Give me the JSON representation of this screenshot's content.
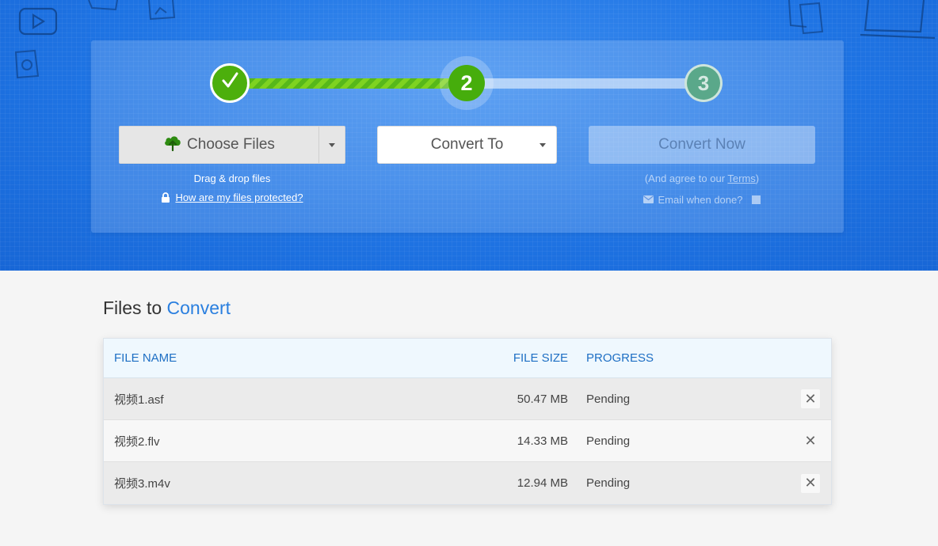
{
  "steps": {
    "step1_icon": "checkmark-icon",
    "step2_label": "2",
    "step3_label": "3"
  },
  "choose_files": {
    "label": "Choose Files",
    "icon": "cloud-upload-icon",
    "drag_drop": "Drag & drop files",
    "protected_link": "How are my files protected?"
  },
  "convert_to": {
    "label": "Convert To"
  },
  "convert_now": {
    "label": "Convert Now",
    "agree_prefix": "(And agree to our ",
    "terms": "Terms",
    "agree_suffix": ")",
    "email_label": "Email when done?"
  },
  "files": {
    "title_plain": "Files to",
    "title_accent": "Convert",
    "headers": {
      "name": "FILE NAME",
      "size": "FILE SIZE",
      "progress": "PROGRESS"
    },
    "rows": [
      {
        "name": "视频1.asf",
        "size": "50.47 MB",
        "progress": "Pending",
        "remove": "✕"
      },
      {
        "name": "视频2.flv",
        "size": "14.33 MB",
        "progress": "Pending",
        "remove": "✕"
      },
      {
        "name": "视频3.m4v",
        "size": "12.94 MB",
        "progress": "Pending",
        "remove": "✕"
      }
    ]
  },
  "colors": {
    "hero_blue": "#1a6ee0",
    "accent_blue": "#2a7fdf",
    "step_green": "#4caf0c"
  }
}
